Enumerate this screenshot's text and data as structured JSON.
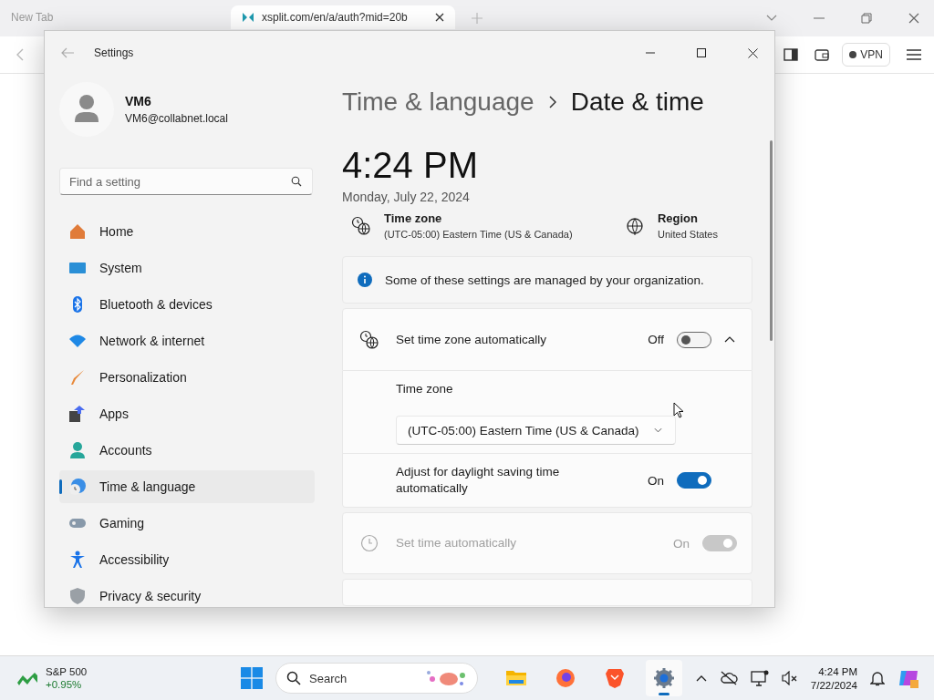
{
  "browser": {
    "tabs": [
      {
        "label": "New Tab",
        "selected": false
      },
      {
        "label": "xsplit.com/en/a/auth?mid=20b",
        "selected": true
      }
    ],
    "vpn": "VPN"
  },
  "settings": {
    "title": "Settings",
    "user": {
      "name": "VM6",
      "email": "VM6@collabnet.local"
    },
    "search": {
      "placeholder": "Find a setting"
    },
    "nav": [
      {
        "label": "Home",
        "selected": false
      },
      {
        "label": "System",
        "selected": false
      },
      {
        "label": "Bluetooth & devices",
        "selected": false
      },
      {
        "label": "Network & internet",
        "selected": false
      },
      {
        "label": "Personalization",
        "selected": false
      },
      {
        "label": "Apps",
        "selected": false
      },
      {
        "label": "Accounts",
        "selected": false
      },
      {
        "label": "Time & language",
        "selected": true
      },
      {
        "label": "Gaming",
        "selected": false
      },
      {
        "label": "Accessibility",
        "selected": false
      },
      {
        "label": "Privacy & security",
        "selected": false
      }
    ],
    "breadcrumb": {
      "parent": "Time & language",
      "current": "Date & time"
    },
    "time": "4:24 PM",
    "date": "Monday, July 22, 2024",
    "summary": [
      {
        "label": "Time zone",
        "value": "(UTC-05:00) Eastern Time (US & Canada)"
      },
      {
        "label": "Region",
        "value": "United States"
      }
    ],
    "notice": "Some of these settings are managed by your organization.",
    "rows": [
      {
        "kind": "toggle",
        "label": "Set time zone automatically",
        "state_text": "Off",
        "on": false,
        "disabled": false,
        "expanded": true
      },
      {
        "kind": "dropdown",
        "label": "Time zone",
        "value": "(UTC-05:00) Eastern Time (US & Canada)"
      },
      {
        "kind": "toggle",
        "label": "Adjust for daylight saving time automatically",
        "state_text": "On",
        "on": true,
        "disabled": false
      },
      {
        "kind": "toggle",
        "label": "Set time automatically",
        "state_text": "On",
        "on": true,
        "disabled": true
      }
    ]
  },
  "taskbar": {
    "widget": {
      "name": "S&P 500",
      "change": "+0.95%"
    },
    "search": {
      "placeholder": "Search"
    },
    "apps": [
      {
        "selected": false
      },
      {
        "selected": false
      },
      {
        "selected": false
      },
      {
        "selected": true
      }
    ],
    "time": "4:24 PM",
    "date": "7/22/2024"
  }
}
